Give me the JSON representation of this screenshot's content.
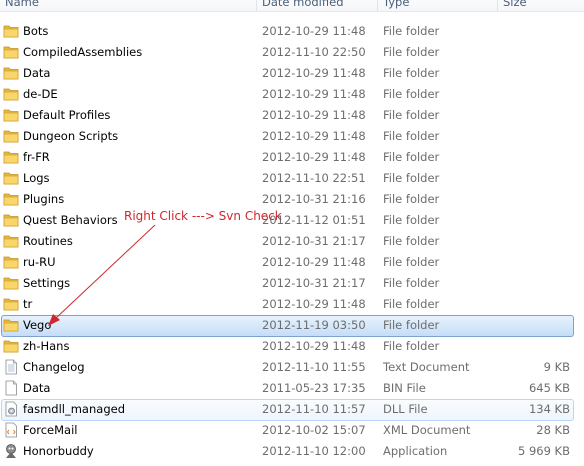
{
  "columns": {
    "name": "Name",
    "date": "Date modified",
    "type": "Type",
    "size": "Size"
  },
  "annotation": {
    "text": "Right Click ---> Svn Check",
    "color": "#d2262c"
  },
  "files": [
    {
      "name": "Bots",
      "date": "2012-10-29 11:48",
      "type": "File folder",
      "size": "",
      "icon": "folder-icon"
    },
    {
      "name": "CompiledAssemblies",
      "date": "2012-11-10 22:50",
      "type": "File folder",
      "size": "",
      "icon": "folder-icon"
    },
    {
      "name": "Data",
      "date": "2012-10-29 11:48",
      "type": "File folder",
      "size": "",
      "icon": "folder-icon"
    },
    {
      "name": "de-DE",
      "date": "2012-10-29 11:48",
      "type": "File folder",
      "size": "",
      "icon": "folder-icon"
    },
    {
      "name": "Default Profiles",
      "date": "2012-10-29 11:48",
      "type": "File folder",
      "size": "",
      "icon": "folder-icon"
    },
    {
      "name": "Dungeon Scripts",
      "date": "2012-10-29 11:48",
      "type": "File folder",
      "size": "",
      "icon": "folder-icon"
    },
    {
      "name": "fr-FR",
      "date": "2012-10-29 11:48",
      "type": "File folder",
      "size": "",
      "icon": "folder-icon"
    },
    {
      "name": "Logs",
      "date": "2012-11-10 22:51",
      "type": "File folder",
      "size": "",
      "icon": "folder-icon"
    },
    {
      "name": "Plugins",
      "date": "2012-10-31 21:16",
      "type": "File folder",
      "size": "",
      "icon": "folder-icon"
    },
    {
      "name": "Quest Behaviors",
      "date": "2012-11-12 01:51",
      "type": "File folder",
      "size": "",
      "icon": "folder-icon"
    },
    {
      "name": "Routines",
      "date": "2012-10-31 21:17",
      "type": "File folder",
      "size": "",
      "icon": "folder-icon"
    },
    {
      "name": "ru-RU",
      "date": "2012-10-29 11:48",
      "type": "File folder",
      "size": "",
      "icon": "folder-icon"
    },
    {
      "name": "Settings",
      "date": "2012-10-31 21:17",
      "type": "File folder",
      "size": "",
      "icon": "folder-icon"
    },
    {
      "name": "tr",
      "date": "2012-10-29 11:48",
      "type": "File folder",
      "size": "",
      "icon": "folder-icon"
    },
    {
      "name": "Vego",
      "date": "2012-11-19 03:50",
      "type": "File folder",
      "size": "",
      "icon": "folder-icon",
      "state": "selected"
    },
    {
      "name": "zh-Hans",
      "date": "2012-10-29 11:48",
      "type": "File folder",
      "size": "",
      "icon": "folder-icon"
    },
    {
      "name": "Changelog",
      "date": "2012-11-10 11:55",
      "type": "Text Document",
      "size": "9 KB",
      "icon": "text-document-icon"
    },
    {
      "name": "Data",
      "date": "2011-05-23 17:35",
      "type": "BIN File",
      "size": "645 KB",
      "icon": "bin-file-icon"
    },
    {
      "name": "fasmdll_managed",
      "date": "2012-11-10 11:57",
      "type": "DLL File",
      "size": "134 KB",
      "icon": "dll-file-icon",
      "state": "hover"
    },
    {
      "name": "ForceMail",
      "date": "2012-10-02 15:07",
      "type": "XML Document",
      "size": "28 KB",
      "icon": "xml-document-icon"
    },
    {
      "name": "Honorbuddy",
      "date": "2012-11-10 12:00",
      "type": "Application",
      "size": "5 969 KB",
      "icon": "application-icon"
    }
  ]
}
